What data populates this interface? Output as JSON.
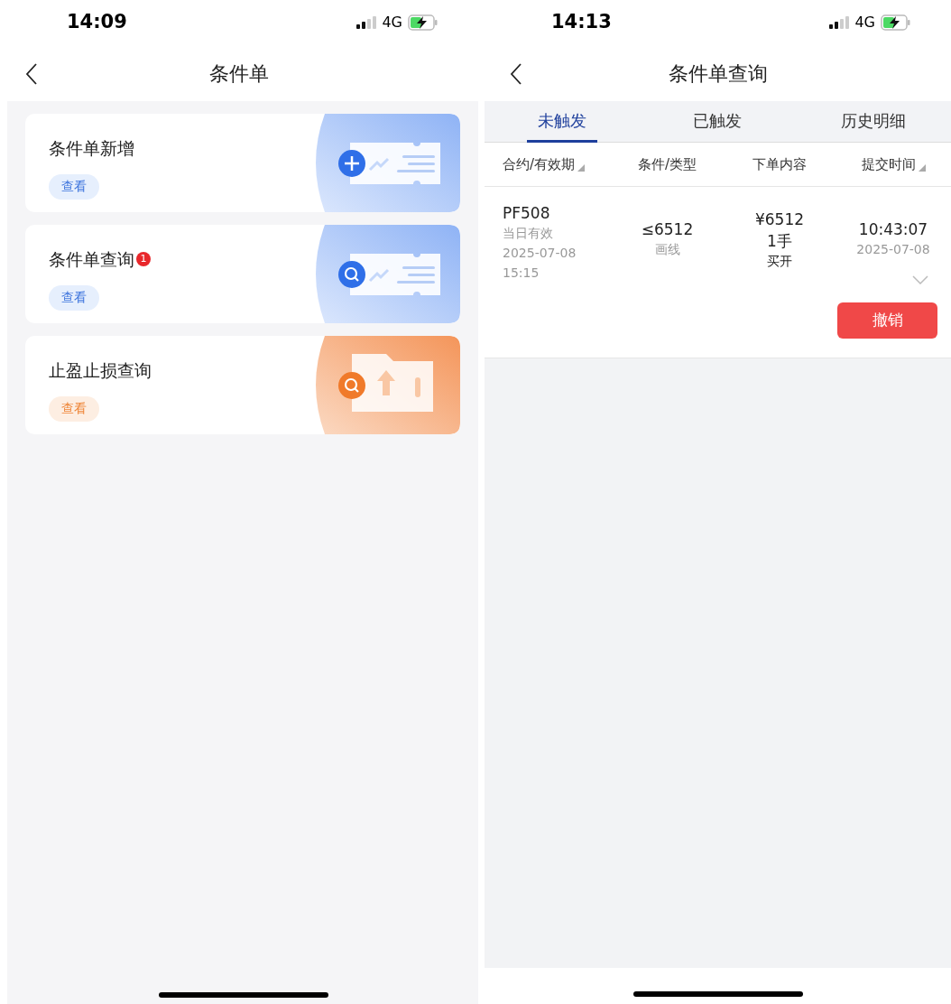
{
  "left_screen": {
    "status_bar": {
      "time": "14:09",
      "network": "4G"
    },
    "nav": {
      "title": "条件单"
    },
    "cards": [
      {
        "kind": "add",
        "title": "条件单新增",
        "action": "查看"
      },
      {
        "kind": "query",
        "title": "条件单查询",
        "badge": "1",
        "action": "查看"
      },
      {
        "kind": "stop_query",
        "title": "止盈止损查询",
        "action": "查看"
      }
    ]
  },
  "right_screen": {
    "status_bar": {
      "time": "14:13",
      "network": "4G"
    },
    "nav": {
      "title": "条件单查询"
    },
    "tabs": [
      {
        "label": "未触发",
        "selected": true
      },
      {
        "label": "已触发",
        "selected": false
      },
      {
        "label": "历史明细",
        "selected": false
      }
    ],
    "columns": [
      {
        "label": "合约/有效期",
        "sortable": true
      },
      {
        "label": "条件/类型",
        "sortable": false
      },
      {
        "label": "下单内容",
        "sortable": false
      },
      {
        "label": "提交时间",
        "sortable": true
      }
    ],
    "orders": [
      {
        "contract": "PF508",
        "validity": "当日有效",
        "expiry_date": "2025-07-08",
        "expiry_time": "15:15",
        "condition": "≤6512",
        "condition_type": "画线",
        "price": "¥6512",
        "quantity": "1手",
        "side": "买开",
        "submit_time": "10:43:07",
        "submit_date": "2025-07-08",
        "expanded": false,
        "action": "撤销"
      }
    ]
  }
}
